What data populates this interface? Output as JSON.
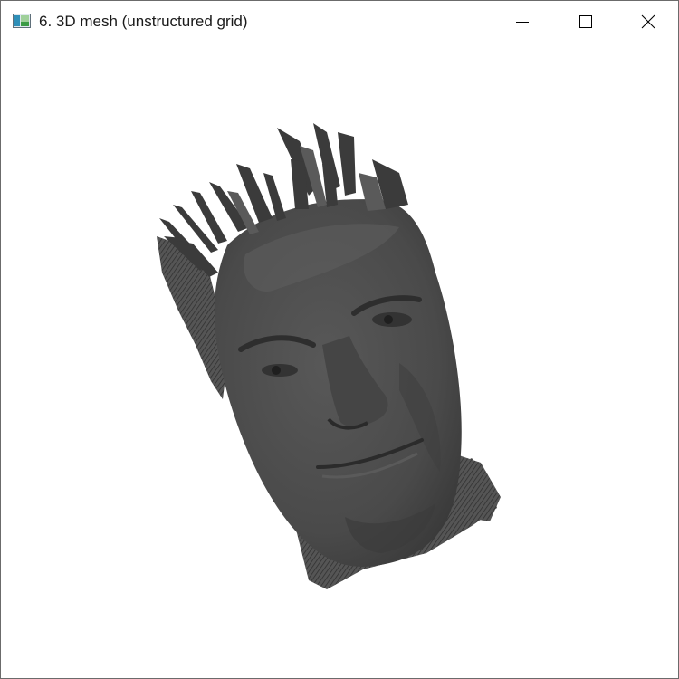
{
  "window": {
    "title": "6. 3D mesh (unstructured grid)",
    "controls": {
      "minimize_icon": "minimize-icon",
      "maximize_icon": "maximize-icon",
      "close_icon": "close-icon"
    }
  },
  "viewport": {
    "background": "#ffffff",
    "mesh_color": "#4a4a4a",
    "content": "head-mesh"
  }
}
